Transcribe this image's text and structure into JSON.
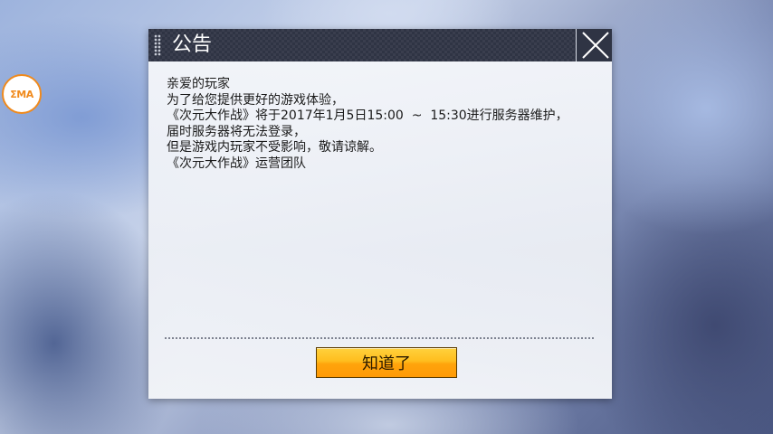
{
  "logo": {
    "text": "ΣMA"
  },
  "dialog": {
    "title": "公告",
    "close_icon": "close-x-icon",
    "lines": [
      "亲爱的玩家",
      "为了给您提供更好的游戏体验，",
      "《次元大作战》将于2017年1月5日15:00  ~  15:30进行服务器维护，",
      "届时服务器将无法登录，",
      "但是游戏内玩家不受影响，敬请谅解。",
      "《次元大作战》运营团队"
    ],
    "confirm_label": "知道了"
  },
  "colors": {
    "title_bar": "#2f3444",
    "button_top": "#ffd23d",
    "button_bottom": "#ff9a06",
    "logo_accent": "#f08a1c"
  }
}
